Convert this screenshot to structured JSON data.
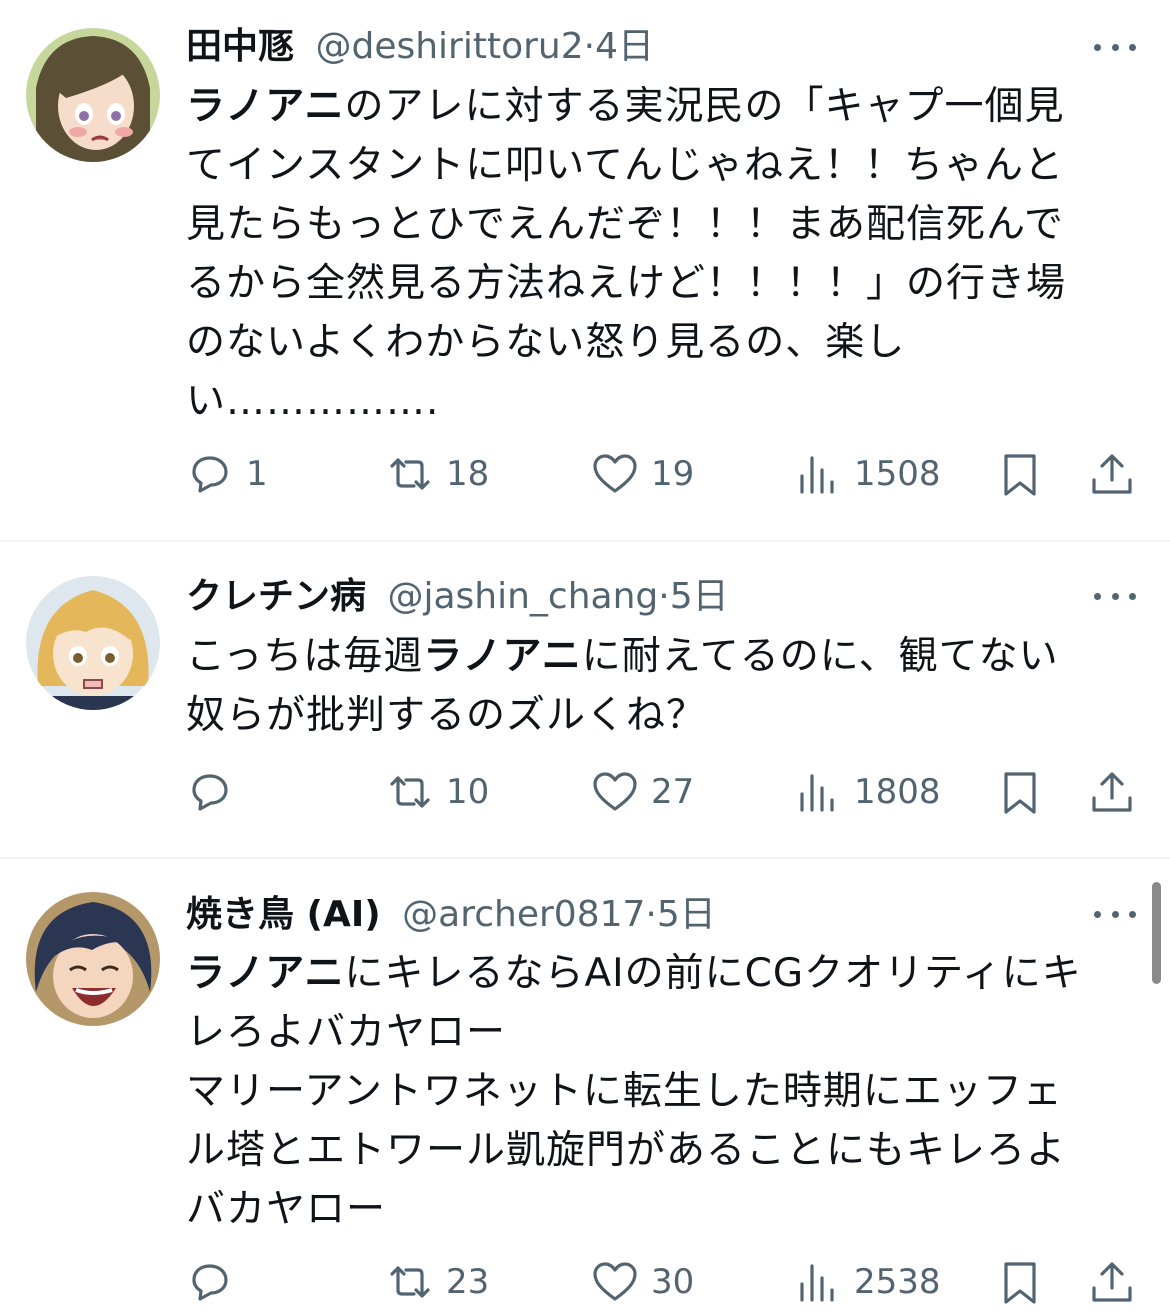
{
  "tweets": [
    {
      "display_name": "田中豗",
      "handle": "@deshirittoru2",
      "separator": "·",
      "time": "4日",
      "body_lines": [
        [
          {
            "t": "ラノアニ",
            "b": true
          },
          {
            "t": "のアレに対する実況民の「キャプ一個見",
            "b": false
          }
        ],
        [
          {
            "t": "てインスタントに叩いてんじゃねえ！！ちゃんと",
            "b": false
          }
        ],
        [
          {
            "t": "見たらもっとひでえんだぞ！！！まあ配信死んで",
            "b": false
          }
        ],
        [
          {
            "t": "るから全然見る方法ねえけど！！！！」の行き場",
            "b": false
          }
        ],
        [
          {
            "t": "のないよくわからない怒り見るの、楽し",
            "b": false
          }
        ],
        [
          {
            "t": "い…………….",
            "b": false
          }
        ]
      ],
      "stats": {
        "replies": "1",
        "retweets": "18",
        "likes": "19",
        "views": "1508"
      }
    },
    {
      "display_name": "クレチン病",
      "handle": "@jashin_chang",
      "separator": "·",
      "time": "5日",
      "body_lines": [
        [
          {
            "t": "こっちは毎週",
            "b": false
          },
          {
            "t": "ラノアニ",
            "b": true
          },
          {
            "t": "に耐えてるのに、観てない",
            "b": false
          }
        ],
        [
          {
            "t": "奴らが批判するのズルくね？",
            "b": false
          }
        ]
      ],
      "stats": {
        "replies": "",
        "retweets": "10",
        "likes": "27",
        "views": "1808"
      }
    },
    {
      "display_name": "焼き鳥 (AI)",
      "handle": "@archer0817",
      "separator": "·",
      "time": "5日",
      "body_lines": [
        [
          {
            "t": "ラノアニ",
            "b": true
          },
          {
            "t": "にキレるならAIの前にCGクオリティにキ",
            "b": false
          }
        ],
        [
          {
            "t": "レろよバカヤロー",
            "b": false
          }
        ],
        [
          {
            "t": "マリーアントワネットに転生した時期にエッフェ",
            "b": false
          }
        ],
        [
          {
            "t": "ル塔とエトワール凱旋門があることにもキレろよ",
            "b": false
          }
        ],
        [
          {
            "t": "バカヤロー",
            "b": false
          }
        ]
      ],
      "stats": {
        "replies": "",
        "retweets": "23",
        "likes": "30",
        "views": "2538"
      }
    }
  ],
  "icons": [
    "reply-icon",
    "retweet-icon",
    "like-icon",
    "views-icon",
    "bookmark-icon",
    "share-icon",
    "more-icon"
  ],
  "colors": {
    "text": "#0f1419",
    "secondary": "#536471",
    "divider": "#eff3f4"
  }
}
